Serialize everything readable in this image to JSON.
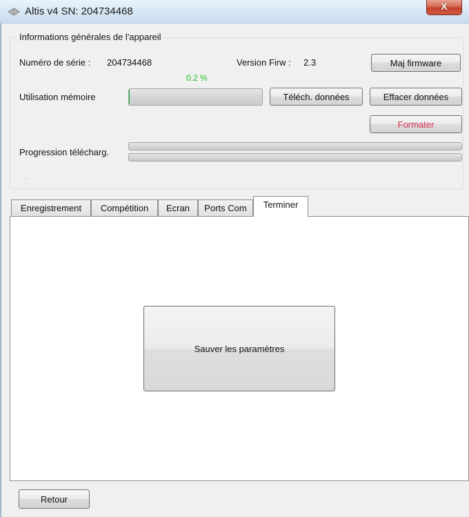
{
  "window": {
    "title": "Altis v4  SN: 204734468",
    "close_glyph": "X"
  },
  "info_group": {
    "title": "Informations générales de l'appareil",
    "serial_label": "Numéro de série :",
    "serial_value": "204734468",
    "firmware_label": "Version Firw :",
    "firmware_value": "2.3",
    "update_firmware_button": "Maj firmware",
    "memory_label": "Utilisation mémoire",
    "memory_percent_text": "0.2 %",
    "memory_fraction": 0.002,
    "download_data_button": "Téléch. données",
    "erase_data_button": "Effacer données",
    "format_button": "Formater",
    "download_progress_label": "Progression télécharg.",
    "download_progress_1": 0,
    "download_progress_2": 0,
    "status_text": "..."
  },
  "tabs": [
    {
      "label": "Enregistrement",
      "active": false
    },
    {
      "label": "Compétition",
      "active": false
    },
    {
      "label": "Ecran",
      "active": false
    },
    {
      "label": "Ports Com",
      "active": false
    },
    {
      "label": "Terminer",
      "active": true
    }
  ],
  "terminer_panel": {
    "save_button": "Sauver les paramètres"
  },
  "footer": {
    "back_button": "Retour"
  },
  "colors": {
    "percent_text": "#22c222",
    "format_button_text": "#d4314f"
  },
  "icons": {
    "app": "altis-app-icon",
    "close": "close-icon"
  }
}
